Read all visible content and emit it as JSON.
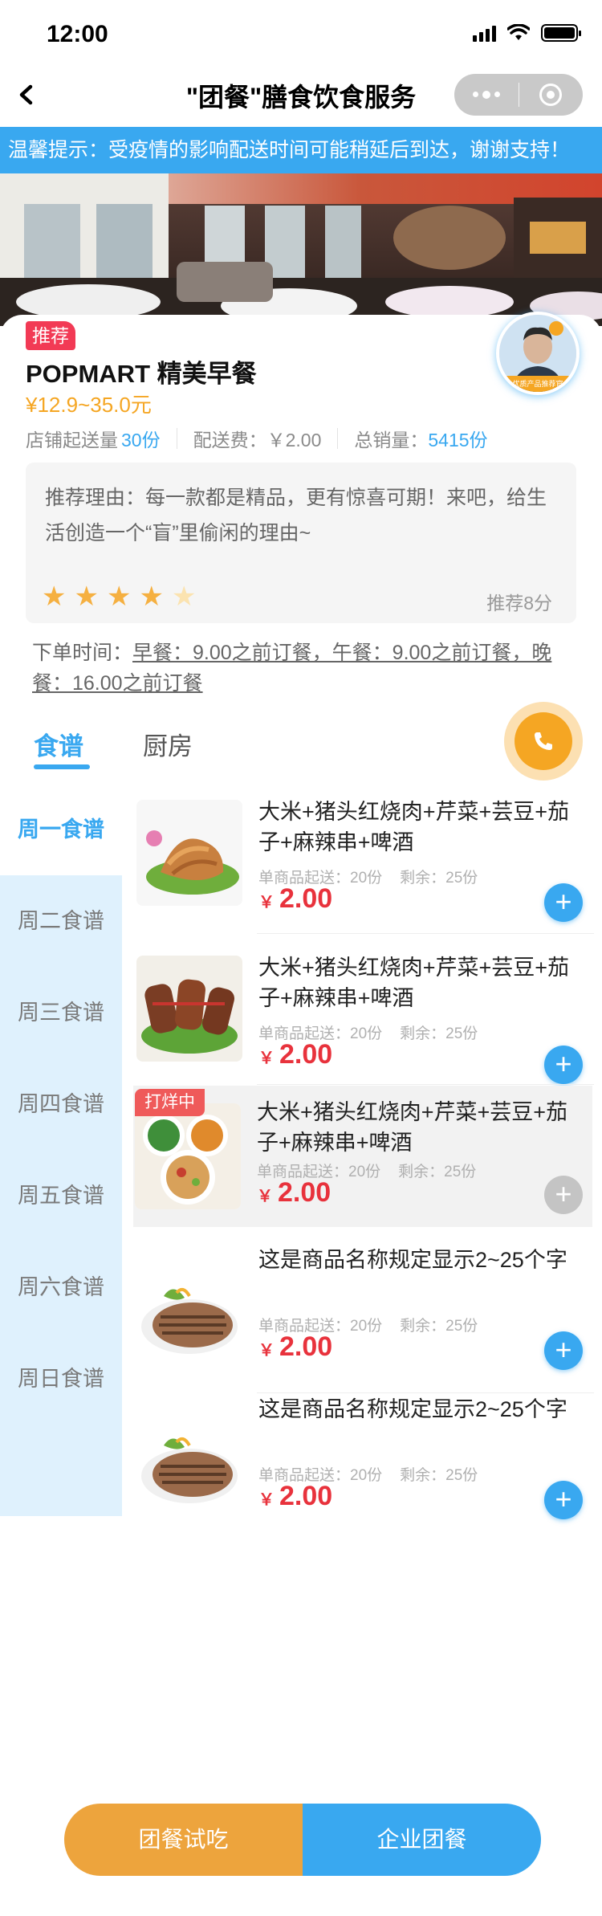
{
  "status_bar": {
    "time": "12:00"
  },
  "nav": {
    "back_icon": "chevron-left-icon",
    "title": "\"团餐\"膳食饮食服务"
  },
  "notice": {
    "text": "温馨提示：受疫情的影响配送时间可能稍延后到达，谢谢支持！"
  },
  "shop": {
    "tag": "推荐",
    "name": "POPMART 精美早餐",
    "price_range": "¥12.9~35.0元",
    "avatar_badge": "优质产品推荐官",
    "stats": {
      "min_order_label": "店铺起送量",
      "min_order_value": "30份",
      "delivery_fee_label": "配送费：",
      "delivery_fee_value": "￥2.00",
      "sales_label": "总销量：",
      "sales_value": "5415份"
    },
    "reason": {
      "text": "推荐理由：每一款都是精品，更有惊喜可期！来吧，给生活创造一个“盲”里偷闲的理由~",
      "rating": 4.5,
      "score": "推荐8分"
    },
    "order_time": {
      "label": "下单时间：",
      "text": "早餐：9.00之前订餐，午餐：9.00之前订餐，晚餐：16.00之前订餐"
    }
  },
  "tabs": [
    {
      "label": "食谱",
      "active": true
    },
    {
      "label": "厨房",
      "active": false
    }
  ],
  "phone_icon": "phone-icon",
  "days": [
    {
      "label": "周一食谱",
      "active": true
    },
    {
      "label": "周二食谱",
      "active": false
    },
    {
      "label": "周三食谱",
      "active": false
    },
    {
      "label": "周四食谱",
      "active": false
    },
    {
      "label": "周五食谱",
      "active": false
    },
    {
      "label": "周六食谱",
      "active": false
    },
    {
      "label": "周日食谱",
      "active": false
    }
  ],
  "products": [
    {
      "name": "大米+猪头红烧肉+芹菜+芸豆+茄子+麻辣串+啤酒",
      "min_order": "单商品起送：20份",
      "remaining": "剩余：25份",
      "currency": "￥",
      "price": "2.00",
      "tag": "",
      "available": true
    },
    {
      "name": "大米+猪头红烧肉+芹菜+芸豆+茄子+麻辣串+啤酒",
      "min_order": "单商品起送：20份",
      "remaining": "剩余：25份",
      "currency": "￥",
      "price": "2.00",
      "tag": "",
      "available": true
    },
    {
      "name": "大米+猪头红烧肉+芹菜+芸豆+茄子+麻辣串+啤酒",
      "min_order": "单商品起送：20份",
      "remaining": "剩余：25份",
      "currency": "￥",
      "price": "2.00",
      "tag": "打烊中",
      "available": false
    },
    {
      "name": "这是商品名称规定显示2~25个字",
      "min_order": "单商品起送：20份",
      "remaining": "剩余：25份",
      "currency": "￥",
      "price": "2.00",
      "tag": "",
      "available": true
    },
    {
      "name": "这是商品名称规定显示2~25个字",
      "min_order": "单商品起送：20份",
      "remaining": "剩余：25份",
      "currency": "￥",
      "price": "2.00",
      "tag": "",
      "available": true
    }
  ],
  "bottom": {
    "trial_label": "团餐试吃",
    "corporate_label": "企业团餐"
  },
  "colors": {
    "accent": "#39a8f0",
    "orange": "#f5a623",
    "price_red": "#e8323c",
    "tag_red": "#f23a55"
  }
}
